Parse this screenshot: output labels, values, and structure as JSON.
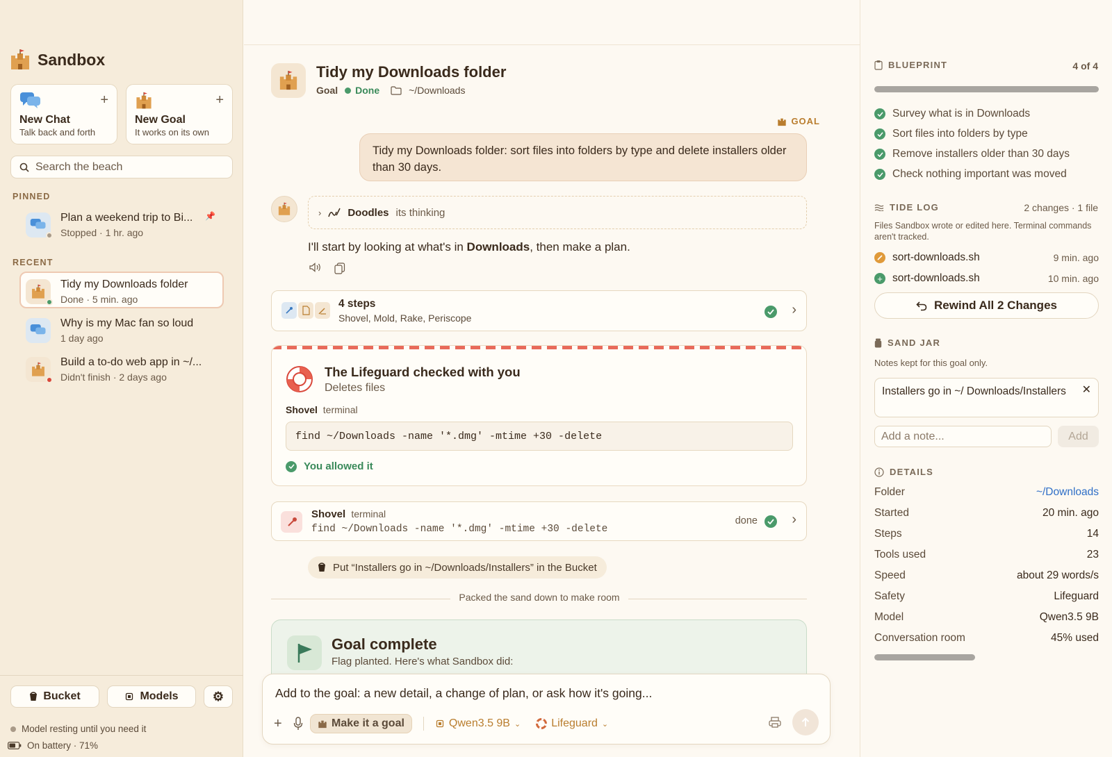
{
  "sidebar": {
    "brand": "Sandbox",
    "new_chat": {
      "title": "New Chat",
      "subtitle": "Talk back and forth",
      "plus": "+"
    },
    "new_goal": {
      "title": "New Goal",
      "subtitle": "It works on its own",
      "plus": "+"
    },
    "search_placeholder": "Search the beach",
    "pinned_label": "PINNED",
    "pinned": [
      {
        "title": "Plan a weekend trip to Bi...",
        "subtitle": "Stopped · 1 hr. ago",
        "kind": "chat",
        "status_color": "#a99a88"
      }
    ],
    "recent_label": "RECENT",
    "recent": [
      {
        "title": "Tidy my Downloads folder",
        "subtitle": "Done · 5 min. ago",
        "kind": "goal",
        "status_color": "#4a9a6a",
        "active": true
      },
      {
        "title": "Why is my Mac fan so loud",
        "subtitle": "1 day ago",
        "kind": "chat"
      },
      {
        "title": "Build a to-do web app in ~/...",
        "subtitle": "Didn't finish · 2 days ago",
        "kind": "goal",
        "status_color": "#d9483b"
      }
    ],
    "bucket_label": "Bucket",
    "models_label": "Models",
    "status_model": "Model resting until you need it",
    "status_battery": "On battery · 71%"
  },
  "main": {
    "title": "Tidy my Downloads folder",
    "meta": {
      "type": "Goal",
      "status": "Done",
      "folder": "~/Downloads"
    },
    "goal_tag": "GOAL",
    "user_message": "Tidy my Downloads folder: sort files into folders by type and delete installers older than 30 days.",
    "thinking": {
      "name": "Doodles",
      "text": "its thinking"
    },
    "assistant": {
      "before": "I'll start by looking at what's in ",
      "bold": "Downloads",
      "after": ", then make a plan."
    },
    "steps": {
      "title": "4 steps",
      "tools": "Shovel, Mold, Rake, Periscope"
    },
    "lifeguard": {
      "title": "The Lifeguard checked with you",
      "subtitle": "Deletes files",
      "tool": "Shovel",
      "tool_type": "terminal",
      "command": "find ~/Downloads -name '*.dmg' -mtime +30 -delete",
      "result": "You allowed it"
    },
    "tool_call": {
      "tool": "Shovel",
      "tool_type": "terminal",
      "command": "find ~/Downloads -name '*.dmg' -mtime +30 -delete",
      "status": "done"
    },
    "bucket_note": "Put “Installers go in ~/Downloads/Installers” in the Bucket",
    "divider": "Packed the sand down to make room",
    "complete": {
      "title": "Goal complete",
      "subtitle": "Flag planted. Here's what Sandbox did:"
    },
    "composer": {
      "placeholder": "Add to the goal: a new detail, a change of plan, or ask how it's going...",
      "make_goal": "Make it a goal",
      "model": "Qwen3.5 9B",
      "safety": "Lifeguard"
    }
  },
  "right": {
    "blueprint": {
      "label": "BLUEPRINT",
      "count": "4 of 4",
      "progress": 1.0,
      "items": [
        "Survey what is in Downloads",
        "Sort files into folders by type",
        "Remove installers older than 30 days",
        "Check nothing important was moved"
      ]
    },
    "tide_log": {
      "label": "TIDE LOG",
      "summary": "2 changes · 1 file",
      "note": "Files Sandbox wrote or edited here. Terminal commands aren't tracked.",
      "items": [
        {
          "file": "sort-downloads.sh",
          "time": "9 min. ago",
          "kind": "edited"
        },
        {
          "file": "sort-downloads.sh",
          "time": "10 min. ago",
          "kind": "created"
        }
      ],
      "rewind": "Rewind All 2 Changes"
    },
    "sand_jar": {
      "label": "SAND JAR",
      "note": "Notes kept for this goal only.",
      "items": [
        "Installers go in ~/ Downloads/Installers"
      ],
      "placeholder": "Add a note...",
      "add": "Add"
    },
    "details": {
      "label": "DETAILS",
      "rows": [
        {
          "k": "Folder",
          "v": "~/Downloads"
        },
        {
          "k": "Started",
          "v": "20 min. ago"
        },
        {
          "k": "Steps",
          "v": "14"
        },
        {
          "k": "Tools used",
          "v": "23"
        },
        {
          "k": "Speed",
          "v": "about 29 words/s"
        },
        {
          "k": "Safety",
          "v": "Lifeguard"
        },
        {
          "k": "Model",
          "v": "Qwen3.5 9B"
        },
        {
          "k": "Conversation room",
          "v": "45% used"
        }
      ],
      "room_used": 0.45
    },
    "colors": {
      "accent": "#b97d2e",
      "done": "#4a9a6a",
      "link": "#2f6fc7"
    }
  }
}
